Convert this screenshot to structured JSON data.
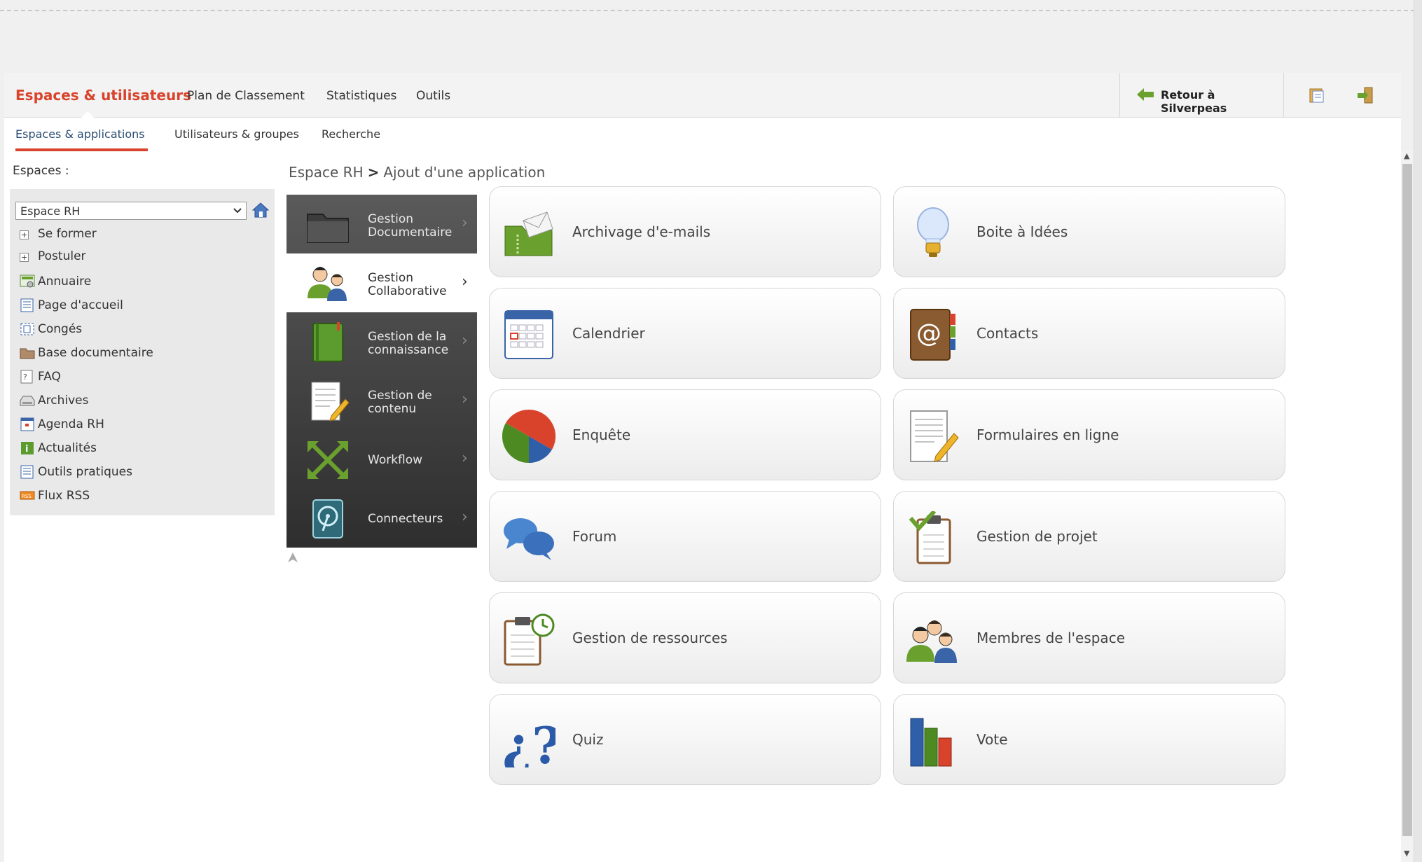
{
  "topnav": {
    "brand": "Espaces & utilisateurs",
    "items": [
      "Plan de Classement",
      "Statistiques",
      "Outils"
    ],
    "retour_label": "Retour à Silverpeas"
  },
  "subnav": {
    "items": [
      "Espaces & applications",
      "Utilisateurs & groupes",
      "Recherche"
    ]
  },
  "left": {
    "espaces_label": "Espaces :",
    "selected_space": "Espace RH",
    "tree": [
      {
        "label": "Se former",
        "icon": "expand-icon"
      },
      {
        "label": "Postuler",
        "icon": "expand-icon"
      },
      {
        "label": "Annuaire",
        "icon": "directory-icon"
      },
      {
        "label": "Page d'accueil",
        "icon": "page-icon"
      },
      {
        "label": "Congés",
        "icon": "calendar-select-icon"
      },
      {
        "label": "Base documentaire",
        "icon": "folder-icon"
      },
      {
        "label": "FAQ",
        "icon": "faq-icon"
      },
      {
        "label": "Archives",
        "icon": "archive-icon"
      },
      {
        "label": "Agenda RH",
        "icon": "agenda-icon"
      },
      {
        "label": "Actualités",
        "icon": "info-icon"
      },
      {
        "label": "Outils pratiques",
        "icon": "page-icon"
      },
      {
        "label": "Flux RSS",
        "icon": "rss-icon"
      }
    ]
  },
  "breadcrumb": {
    "space": "Espace RH",
    "sep": ">",
    "current": "Ajout d'une application"
  },
  "categories": [
    {
      "line1": "Gestion",
      "line2": "Documentaire",
      "icon": "folder-icon"
    },
    {
      "line1": "Gestion",
      "line2": "Collaborative",
      "icon": "people-icon"
    },
    {
      "line1": "Gestion de la",
      "line2": "connaissance",
      "icon": "book-icon"
    },
    {
      "line1": "Gestion de",
      "line2": "contenu",
      "icon": "document-edit-icon"
    },
    {
      "line1": "Workflow",
      "line2": "",
      "icon": "workflow-icon"
    },
    {
      "line1": "Connecteurs",
      "line2": "",
      "icon": "disk-icon"
    }
  ],
  "apps": [
    {
      "label": "Archivage d'e-mails",
      "icon": "mail-archive-icon"
    },
    {
      "label": "Boite à Idées",
      "icon": "lightbulb-icon"
    },
    {
      "label": "Calendrier",
      "icon": "calendar-icon"
    },
    {
      "label": "Contacts",
      "icon": "address-book-icon"
    },
    {
      "label": "Enquête",
      "icon": "pie-chart-icon"
    },
    {
      "label": "Formulaires en ligne",
      "icon": "form-icon"
    },
    {
      "label": "Forum",
      "icon": "speech-bubbles-icon"
    },
    {
      "label": "Gestion de projet",
      "icon": "clipboard-check-icon"
    },
    {
      "label": "Gestion de ressources",
      "icon": "clipboard-clock-icon"
    },
    {
      "label": "Membres de l'espace",
      "icon": "group-icon"
    },
    {
      "label": "Quiz",
      "icon": "question-icon"
    },
    {
      "label": "Vote",
      "icon": "bar-chart-icon"
    }
  ],
  "colors": {
    "accent": "#d9432c",
    "active_subnav": "#2a4c72"
  }
}
